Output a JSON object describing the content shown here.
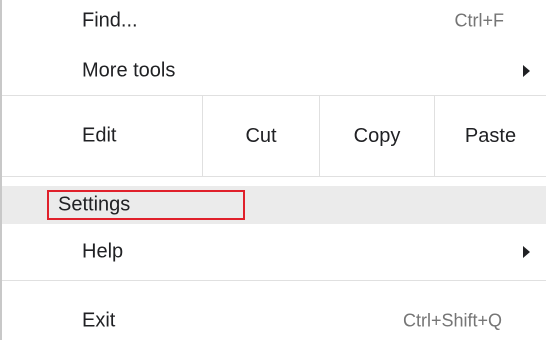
{
  "menu": {
    "find": {
      "label": "Find...",
      "shortcut": "Ctrl+F"
    },
    "more_tools": {
      "label": "More tools"
    },
    "edit": {
      "label": "Edit",
      "cut": "Cut",
      "copy": "Copy",
      "paste": "Paste"
    },
    "settings": {
      "label": "Settings"
    },
    "help": {
      "label": "Help"
    },
    "exit": {
      "label": "Exit",
      "shortcut": "Ctrl+Shift+Q"
    }
  },
  "colors": {
    "highlight": "#ebebeb",
    "selection_box": "#e0202b"
  }
}
